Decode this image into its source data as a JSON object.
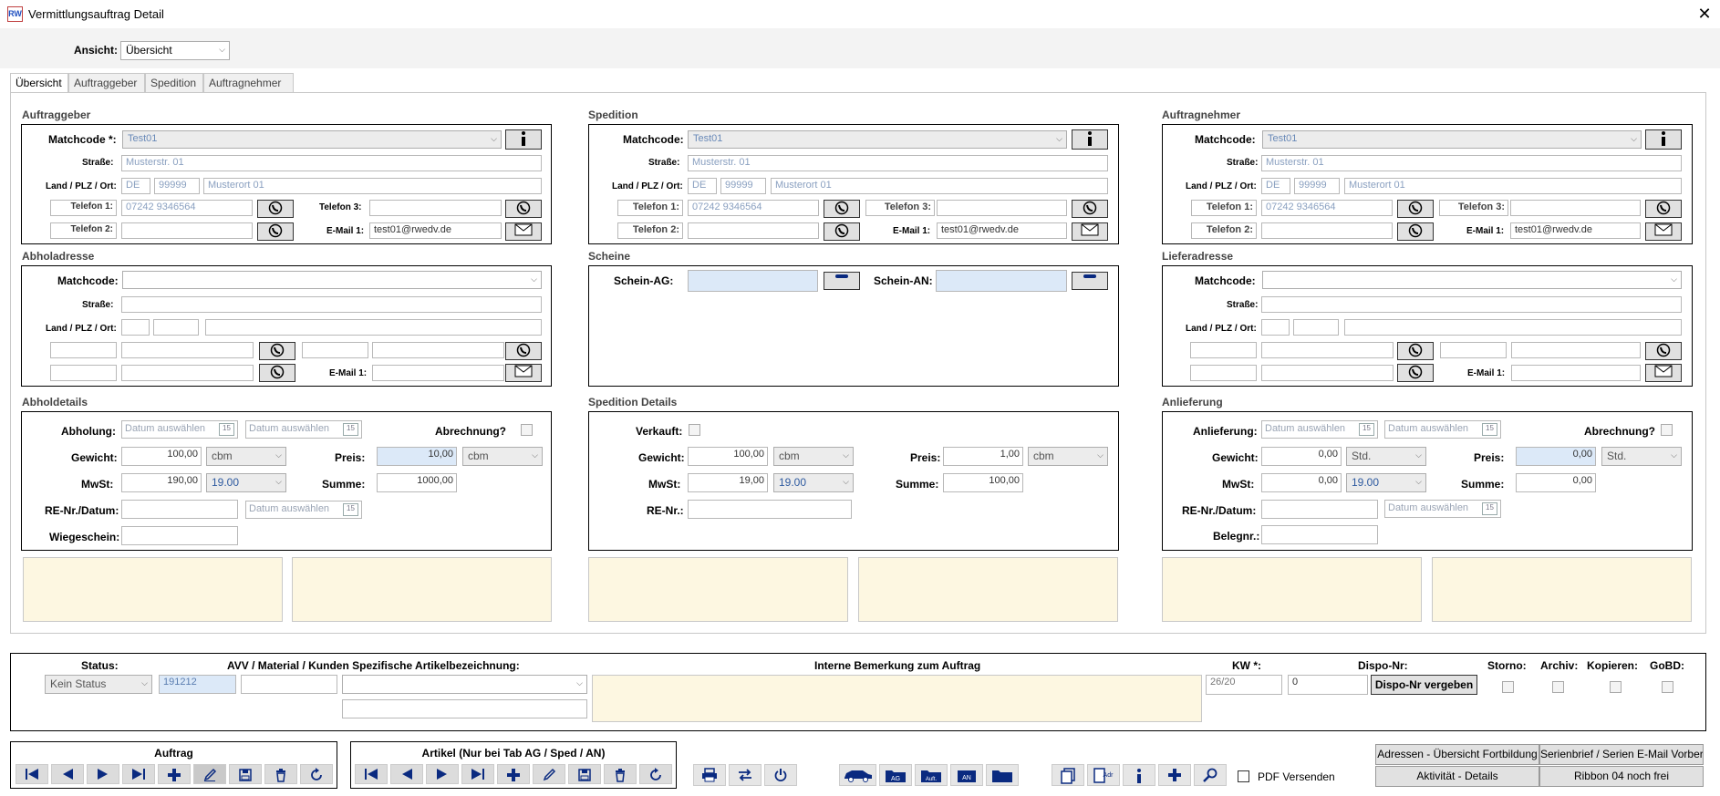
{
  "window": {
    "title": "Vermittlungsauftrag Detail",
    "app_icon": "RW"
  },
  "view": {
    "label": "Ansicht:",
    "value": "Übersicht"
  },
  "tabs": [
    "Übersicht",
    "Auftraggeber",
    "Spedition",
    "Auftragnehmer"
  ],
  "labels": {
    "matchcode_req": "Matchcode *:",
    "matchcode": "Matchcode:",
    "strasse": "Straße:",
    "land": "Land / PLZ / Ort:",
    "tel1": "Telefon 1:",
    "tel2": "Telefon 2:",
    "tel3": "Telefon 3:",
    "email1": "E-Mail 1:",
    "schein_ag": "Schein-AG:",
    "schein_an": "Schein-AN:",
    "abholung": "Abholung:",
    "anlieferung": "Anlieferung:",
    "verkauft": "Verkauft:",
    "abrechnung": "Abrechnung?",
    "gewicht": "Gewicht:",
    "preis": "Preis:",
    "mwst": "MwSt:",
    "summe": "Summe:",
    "re_datum": "RE-Nr./Datum:",
    "re_nr": "RE-Nr.:",
    "wiegeschein": "Wiegeschein:",
    "belegnr": "Belegnr.:",
    "date_placeholder": "Datum auswählen"
  },
  "sections": {
    "auftraggeber": "Auftraggeber",
    "spedition": "Spedition",
    "auftragnehmer": "Auftragnehmer",
    "abholadresse": "Abholadresse",
    "scheine": "Scheine",
    "lieferadresse": "Lieferadresse",
    "abholdetails": "Abholdetails",
    "spedition_details": "Spedition Details",
    "anlieferung": "Anlieferung"
  },
  "party": {
    "matchcode": "Test01",
    "strasse": "Musterstr. 01",
    "land": "DE",
    "plz": "99999",
    "ort": "Musterort 01",
    "tel1": "07242 9346564",
    "email1": "test01@rwedv.de"
  },
  "abholdetails": {
    "gewicht": "100,00",
    "gewicht_unit": "cbm",
    "preis": "10,00",
    "preis_unit": "cbm",
    "mwst": "190,00",
    "mwst_rate": "19.00",
    "summe": "1000,00"
  },
  "speditiondetails": {
    "gewicht": "100,00",
    "gewicht_unit": "cbm",
    "preis": "1,00",
    "preis_unit": "cbm",
    "mwst": "19,00",
    "mwst_rate": "19.00",
    "summe": "100,00"
  },
  "anlieferungdetails": {
    "gewicht": "0,00",
    "gewicht_unit": "Std.",
    "preis": "0,00",
    "preis_unit": "Std.",
    "mwst": "0,00",
    "mwst_rate": "19.00",
    "summe": "0,00"
  },
  "bottom": {
    "status_label": "Status:",
    "status_value": "Kein Status",
    "avv_label": "AVV / Material / Kunden Spezifische Artikelbezeichnung:",
    "avv_code": "191212",
    "bemerkung_label": "Interne Bemerkung zum Auftrag",
    "kw_label": "KW *:",
    "kw_value": "26/20",
    "dispo_label": "Dispo-Nr:",
    "dispo_value": "0",
    "dispo_button": "Dispo-Nr vergeben",
    "storno": "Storno:",
    "archiv": "Archiv:",
    "kopieren": "Kopieren:",
    "gobd": "GoBD:"
  },
  "toolbar": {
    "auftrag": "Auftrag",
    "artikel": "Artikel (Nur bei Tab AG / Sped / AN)",
    "pdf": "PDF Versenden",
    "ag": "AG",
    "auft": "Auft.",
    "an": "AN",
    "adr": "Adr"
  },
  "right_buttons": {
    "b1": "Adressen - Übersicht Fortbildung",
    "b2": "Serienbrief / Serien E-Mail Vorber",
    "b3": "Aktivität - Details",
    "b4": "Ribbon 04 noch frei"
  }
}
